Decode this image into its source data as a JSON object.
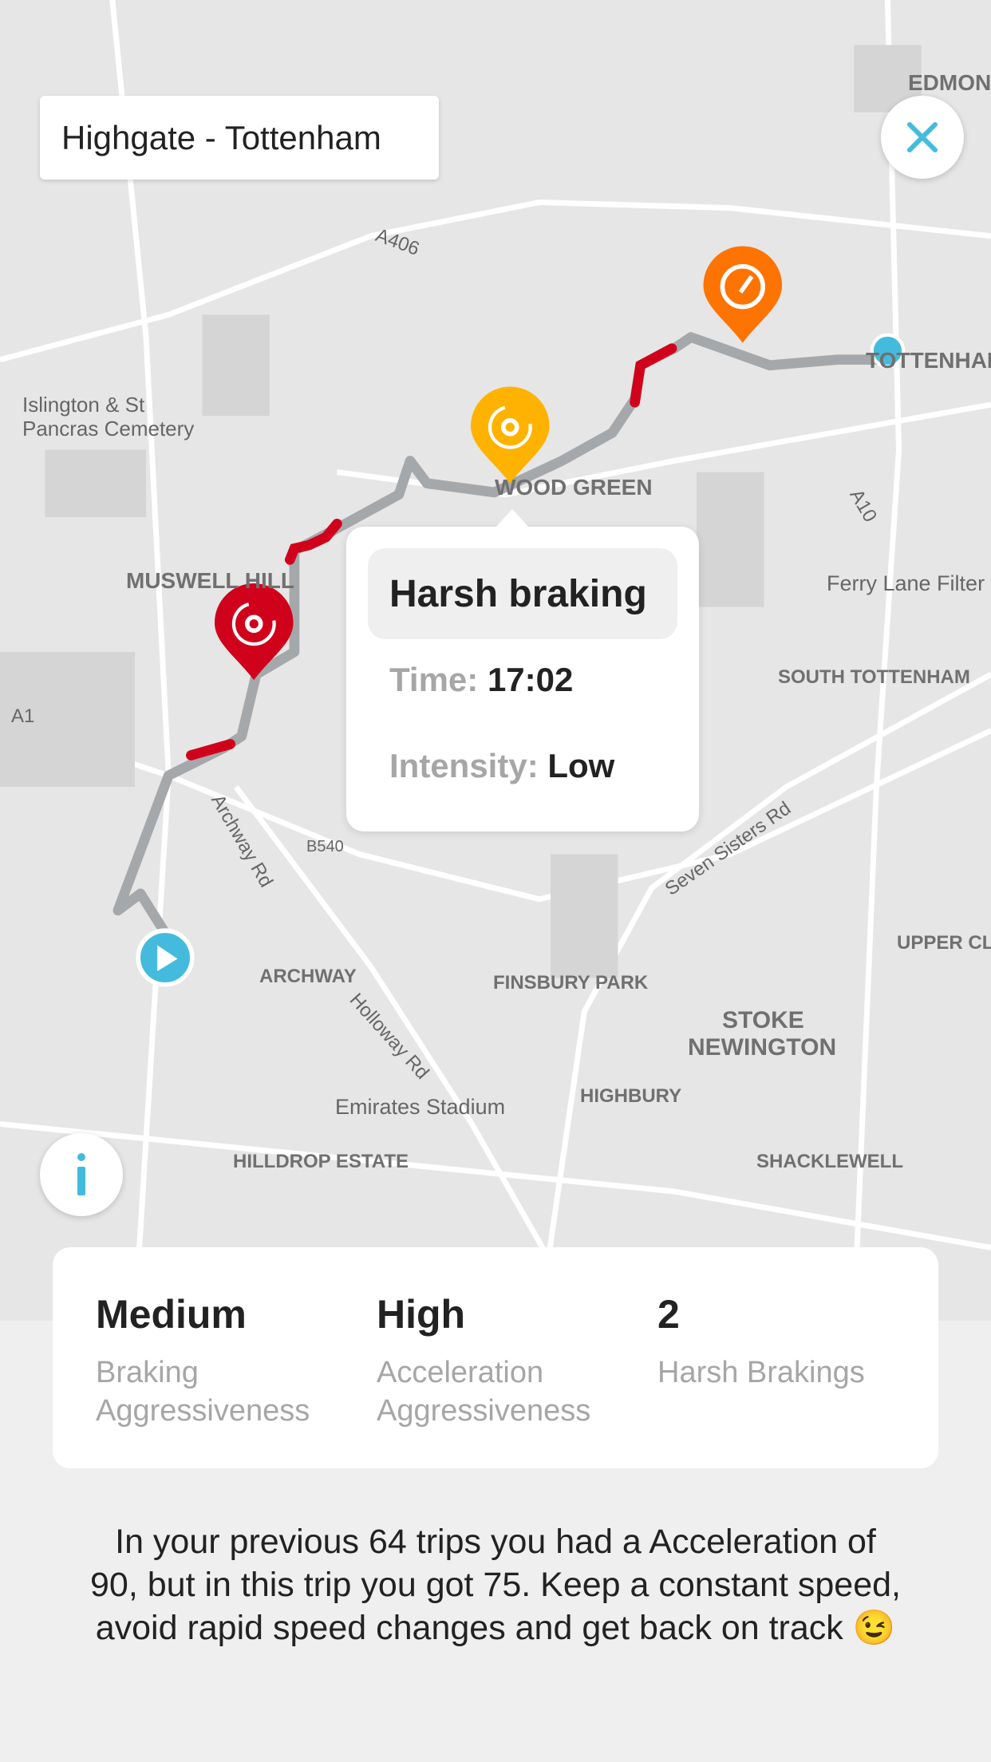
{
  "trip": {
    "title": "Highgate - Tottenham"
  },
  "buttons": {
    "close_icon": "close-icon",
    "info_icon": "info-icon"
  },
  "colors": {
    "route": "#a5a8ab",
    "harsh_segment": "#d0021b",
    "harsh_braking_pin": "#d0021b",
    "braking_pin": "#ffb300",
    "acceleration_pin": "#ff7300",
    "start_end": "#44bbdd",
    "accent": "#44bbdd"
  },
  "map_labels": [
    "MUSWELL HILL",
    "WOOD GREEN",
    "TOTTENHAM",
    "SOUTH TOTTENHAM",
    "Ferry Lane Filter",
    "ARCHWAY",
    "FINSBURY PARK",
    "STOKE",
    "NEWINGTON",
    "HIGHBURY",
    "Emirates Stadium",
    "HILLDROP ESTATE",
    "SHACKLEWELL",
    "UPPER CLA",
    "Islington & St",
    "Pancras Cemetery",
    "EDMON",
    "A406",
    "A10",
    "A1",
    "B540",
    "Archway Rd",
    "Holloway Rd",
    "Seven Sisters Rd"
  ],
  "tooltip": {
    "title": "Harsh braking",
    "time_label": "Time:",
    "time_value": "17:02",
    "intensity_label": "Intensity:",
    "intensity_value": "Low"
  },
  "stats": [
    {
      "value": "Medium",
      "label": "Braking Aggressiveness"
    },
    {
      "value": "High",
      "label": "Acceleration Aggressiveness"
    },
    {
      "value": "2",
      "label": "Harsh Brakings"
    }
  ],
  "message": "In your previous 64 trips you had a Acceleration of 90, but in this trip you got 75. Keep a constant speed, avoid rapid speed changes and get back on track 😉"
}
